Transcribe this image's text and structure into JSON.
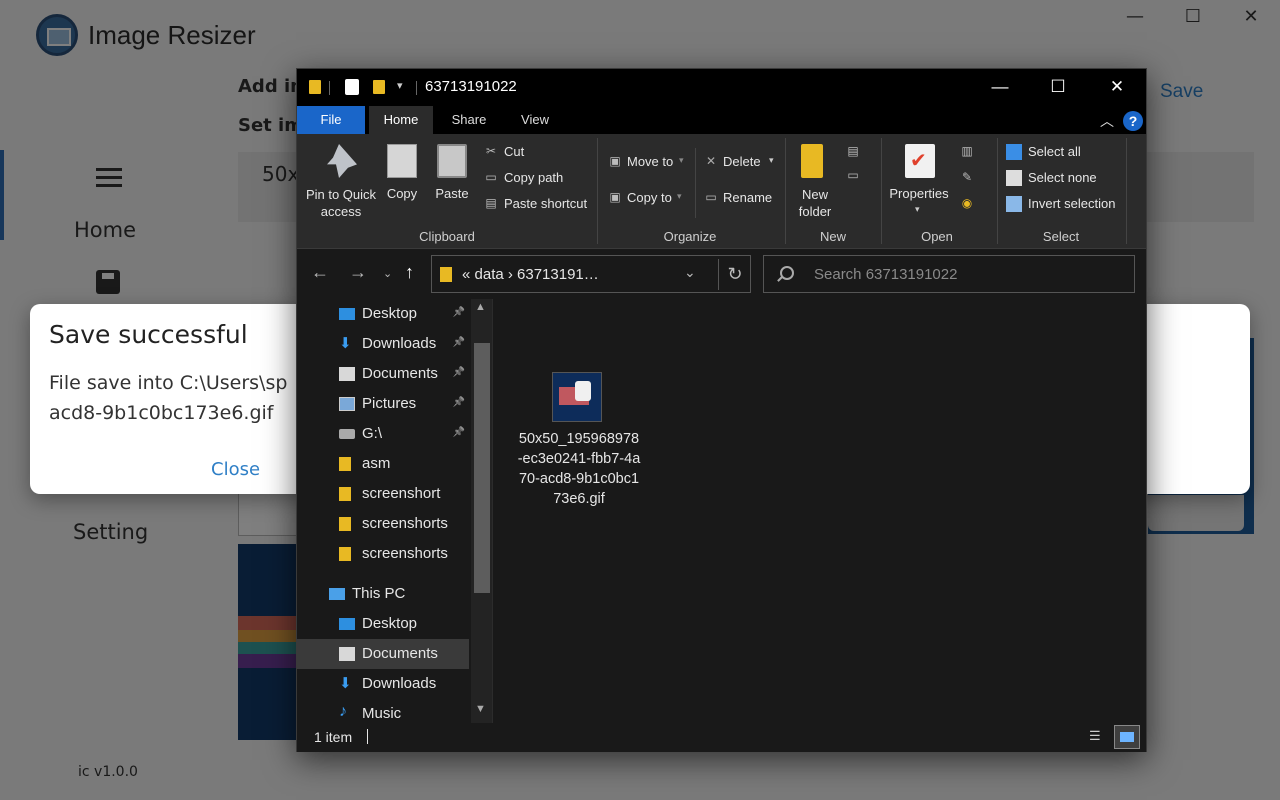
{
  "app": {
    "title": "Image Resizer",
    "add_label": "Add im",
    "set_label": "Set im",
    "size_text": "50x",
    "save_label": "Save",
    "nav": {
      "home": "Home",
      "setting": "Setting"
    },
    "version": "ic v1.0.0",
    "window_controls": {
      "minimize": "—",
      "maximize": "☐",
      "close": "✕"
    }
  },
  "dialog": {
    "title": "Save successful",
    "body": "File save into C:\\Users\\sp\nacd8-9b1c0bc173e6.gif",
    "close_label": "Close"
  },
  "explorer": {
    "title": "63713191022",
    "controls": {
      "minimize": "—",
      "maximize": "☐",
      "close": "✕"
    },
    "tabs": [
      "File",
      "Home",
      "Share",
      "View"
    ],
    "ribbon": {
      "clipboard": {
        "pin_label": "Pin to Quick access",
        "copy_label": "Copy",
        "paste_label": "Paste",
        "cut_label": "Cut",
        "copy_path_label": "Copy path",
        "paste_shortcut_label": "Paste shortcut",
        "group_label": "Clipboard"
      },
      "organize": {
        "move_to_label": "Move to",
        "copy_to_label": "Copy to",
        "delete_label": "Delete",
        "rename_label": "Rename",
        "group_label": "Organize"
      },
      "new": {
        "new_folder_label": "New folder",
        "group_label": "New"
      },
      "open": {
        "properties_label": "Properties",
        "group_label": "Open"
      },
      "select": {
        "select_all_label": "Select all",
        "select_none_label": "Select none",
        "invert_label": "Invert selection",
        "group_label": "Select"
      }
    },
    "address": {
      "crumbs": "« data › 63713191…"
    },
    "search": {
      "placeholder": "Search 63713191022"
    },
    "nav_items": [
      {
        "label": "Desktop",
        "icon": "desktop-icon",
        "pinned": true
      },
      {
        "label": "Downloads",
        "icon": "download-icon",
        "pinned": true
      },
      {
        "label": "Documents",
        "icon": "document-icon",
        "pinned": true
      },
      {
        "label": "Pictures",
        "icon": "pictures-icon",
        "pinned": true
      },
      {
        "label": "G:\\",
        "icon": "drive-icon",
        "pinned": true
      },
      {
        "label": "asm",
        "icon": "folder-icon",
        "pinned": false
      },
      {
        "label": "screenshort",
        "icon": "folder-icon",
        "pinned": false
      },
      {
        "label": "screenshorts",
        "icon": "folder-icon",
        "pinned": false
      },
      {
        "label": "screenshorts",
        "icon": "folder-icon",
        "pinned": false
      },
      {
        "label": "This PC",
        "icon": "computer-icon",
        "pinned": false
      },
      {
        "label": "Desktop",
        "icon": "desktop-icon",
        "pinned": false
      },
      {
        "label": "Documents",
        "icon": "document-icon",
        "pinned": false
      },
      {
        "label": "Downloads",
        "icon": "download-icon",
        "pinned": false
      },
      {
        "label": "Music",
        "icon": "music-icon",
        "pinned": false
      }
    ],
    "file": {
      "name": "50x50_195968978-ec3e0241-fbb7-4a70-acd8-9b1c0bc173e6.gif"
    },
    "status": {
      "count": "1 item"
    },
    "colors": {
      "accent": "#1a66c9",
      "folder": "#e8b923",
      "bg": "#191919"
    }
  }
}
